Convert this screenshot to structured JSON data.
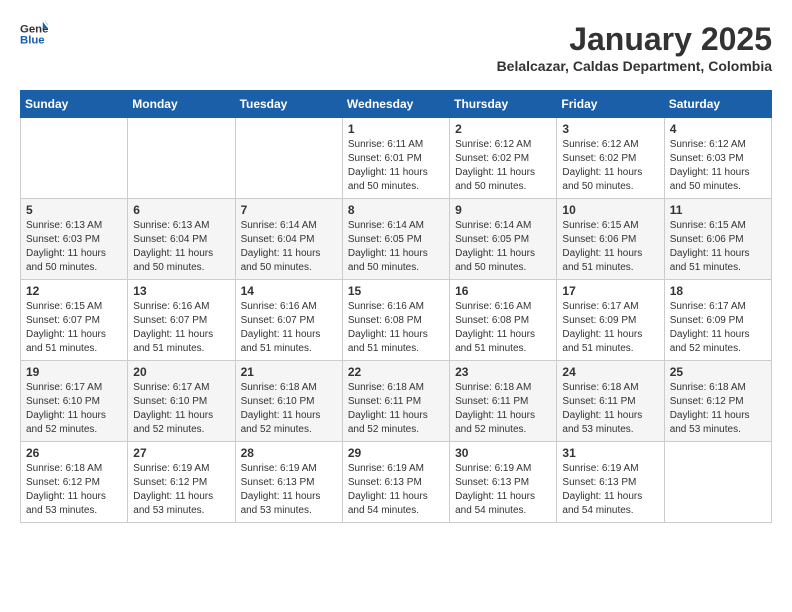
{
  "header": {
    "logo_general": "General",
    "logo_blue": "Blue",
    "month": "January 2025",
    "location": "Belalcazar, Caldas Department, Colombia"
  },
  "weekdays": [
    "Sunday",
    "Monday",
    "Tuesday",
    "Wednesday",
    "Thursday",
    "Friday",
    "Saturday"
  ],
  "weeks": [
    [
      {
        "day": "",
        "info": ""
      },
      {
        "day": "",
        "info": ""
      },
      {
        "day": "",
        "info": ""
      },
      {
        "day": "1",
        "info": "Sunrise: 6:11 AM\nSunset: 6:01 PM\nDaylight: 11 hours\nand 50 minutes."
      },
      {
        "day": "2",
        "info": "Sunrise: 6:12 AM\nSunset: 6:02 PM\nDaylight: 11 hours\nand 50 minutes."
      },
      {
        "day": "3",
        "info": "Sunrise: 6:12 AM\nSunset: 6:02 PM\nDaylight: 11 hours\nand 50 minutes."
      },
      {
        "day": "4",
        "info": "Sunrise: 6:12 AM\nSunset: 6:03 PM\nDaylight: 11 hours\nand 50 minutes."
      }
    ],
    [
      {
        "day": "5",
        "info": "Sunrise: 6:13 AM\nSunset: 6:03 PM\nDaylight: 11 hours\nand 50 minutes."
      },
      {
        "day": "6",
        "info": "Sunrise: 6:13 AM\nSunset: 6:04 PM\nDaylight: 11 hours\nand 50 minutes."
      },
      {
        "day": "7",
        "info": "Sunrise: 6:14 AM\nSunset: 6:04 PM\nDaylight: 11 hours\nand 50 minutes."
      },
      {
        "day": "8",
        "info": "Sunrise: 6:14 AM\nSunset: 6:05 PM\nDaylight: 11 hours\nand 50 minutes."
      },
      {
        "day": "9",
        "info": "Sunrise: 6:14 AM\nSunset: 6:05 PM\nDaylight: 11 hours\nand 50 minutes."
      },
      {
        "day": "10",
        "info": "Sunrise: 6:15 AM\nSunset: 6:06 PM\nDaylight: 11 hours\nand 51 minutes."
      },
      {
        "day": "11",
        "info": "Sunrise: 6:15 AM\nSunset: 6:06 PM\nDaylight: 11 hours\nand 51 minutes."
      }
    ],
    [
      {
        "day": "12",
        "info": "Sunrise: 6:15 AM\nSunset: 6:07 PM\nDaylight: 11 hours\nand 51 minutes."
      },
      {
        "day": "13",
        "info": "Sunrise: 6:16 AM\nSunset: 6:07 PM\nDaylight: 11 hours\nand 51 minutes."
      },
      {
        "day": "14",
        "info": "Sunrise: 6:16 AM\nSunset: 6:07 PM\nDaylight: 11 hours\nand 51 minutes."
      },
      {
        "day": "15",
        "info": "Sunrise: 6:16 AM\nSunset: 6:08 PM\nDaylight: 11 hours\nand 51 minutes."
      },
      {
        "day": "16",
        "info": "Sunrise: 6:16 AM\nSunset: 6:08 PM\nDaylight: 11 hours\nand 51 minutes."
      },
      {
        "day": "17",
        "info": "Sunrise: 6:17 AM\nSunset: 6:09 PM\nDaylight: 11 hours\nand 51 minutes."
      },
      {
        "day": "18",
        "info": "Sunrise: 6:17 AM\nSunset: 6:09 PM\nDaylight: 11 hours\nand 52 minutes."
      }
    ],
    [
      {
        "day": "19",
        "info": "Sunrise: 6:17 AM\nSunset: 6:10 PM\nDaylight: 11 hours\nand 52 minutes."
      },
      {
        "day": "20",
        "info": "Sunrise: 6:17 AM\nSunset: 6:10 PM\nDaylight: 11 hours\nand 52 minutes."
      },
      {
        "day": "21",
        "info": "Sunrise: 6:18 AM\nSunset: 6:10 PM\nDaylight: 11 hours\nand 52 minutes."
      },
      {
        "day": "22",
        "info": "Sunrise: 6:18 AM\nSunset: 6:11 PM\nDaylight: 11 hours\nand 52 minutes."
      },
      {
        "day": "23",
        "info": "Sunrise: 6:18 AM\nSunset: 6:11 PM\nDaylight: 11 hours\nand 52 minutes."
      },
      {
        "day": "24",
        "info": "Sunrise: 6:18 AM\nSunset: 6:11 PM\nDaylight: 11 hours\nand 53 minutes."
      },
      {
        "day": "25",
        "info": "Sunrise: 6:18 AM\nSunset: 6:12 PM\nDaylight: 11 hours\nand 53 minutes."
      }
    ],
    [
      {
        "day": "26",
        "info": "Sunrise: 6:18 AM\nSunset: 6:12 PM\nDaylight: 11 hours\nand 53 minutes."
      },
      {
        "day": "27",
        "info": "Sunrise: 6:19 AM\nSunset: 6:12 PM\nDaylight: 11 hours\nand 53 minutes."
      },
      {
        "day": "28",
        "info": "Sunrise: 6:19 AM\nSunset: 6:13 PM\nDaylight: 11 hours\nand 53 minutes."
      },
      {
        "day": "29",
        "info": "Sunrise: 6:19 AM\nSunset: 6:13 PM\nDaylight: 11 hours\nand 54 minutes."
      },
      {
        "day": "30",
        "info": "Sunrise: 6:19 AM\nSunset: 6:13 PM\nDaylight: 11 hours\nand 54 minutes."
      },
      {
        "day": "31",
        "info": "Sunrise: 6:19 AM\nSunset: 6:13 PM\nDaylight: 11 hours\nand 54 minutes."
      },
      {
        "day": "",
        "info": ""
      }
    ]
  ]
}
